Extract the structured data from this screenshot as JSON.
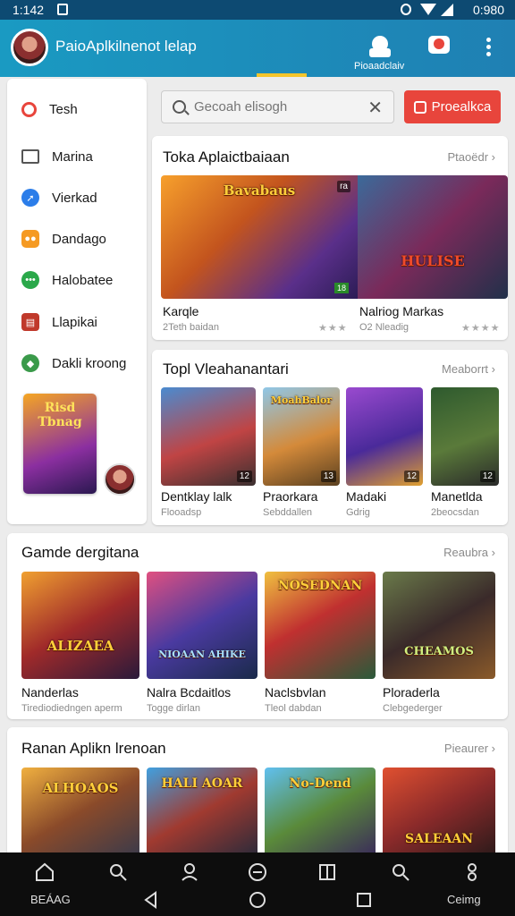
{
  "status": {
    "time": "1:142",
    "right": "0:980"
  },
  "appbar": {
    "title": "PaioAplkilnenot lelap",
    "button_label": "Pioaadclaiv"
  },
  "sidebar": {
    "items": [
      {
        "label": "Tesh",
        "icon": "search-icon",
        "color": "#e8453c"
      },
      {
        "label": "Marina",
        "icon": "list-icon",
        "color": "#555555"
      },
      {
        "label": "Vierkad",
        "icon": "compass-icon",
        "color": "#2b7de9"
      },
      {
        "label": "Dandago",
        "icon": "gamepad-icon",
        "color": "#f59a23"
      },
      {
        "label": "Halobatee",
        "icon": "chat-icon",
        "color": "#2aa84a"
      },
      {
        "label": "Llapikai",
        "icon": "tv-icon",
        "color": "#c0392b"
      },
      {
        "label": "Dakli kroong",
        "icon": "game-icon",
        "color": "#3a9a4a"
      }
    ],
    "promo_title": "Risd Tbnag"
  },
  "search": {
    "placeholder": "Gecoah elisogh",
    "button": "Proealkca"
  },
  "featured": {
    "title": "Toka Aplaictbaiaan",
    "more": "Ptaoëdr",
    "items": [
      {
        "name": "Karqle",
        "sub": "2Teth baidan",
        "art": "Bavabaus",
        "badge": "ra",
        "stars": "★★★"
      },
      {
        "name": "Nalriog Markas",
        "sub": "O2 Nleadig",
        "art": "HULISE",
        "stars": "★★★★"
      }
    ]
  },
  "top": {
    "title": "Topl Vleahanantari",
    "more": "Meaborrt",
    "items": [
      {
        "name": "Dentklay lalk",
        "sub": "Flooadsp",
        "art": "",
        "num": "12"
      },
      {
        "name": "Praorkara",
        "sub": "Sebddallen",
        "art": "MoahBalor",
        "num": "13"
      },
      {
        "name": "Madaki",
        "sub": "Gdrig",
        "art": "",
        "num": "12"
      },
      {
        "name": "Manetlda",
        "sub": "2beocsdan",
        "art": "",
        "num": "12"
      }
    ]
  },
  "games": {
    "title": "Gamde dergitana",
    "more": "Reaubra",
    "items": [
      {
        "name": "Nanderlas",
        "sub": "Tirediodiedngen aperm",
        "art": "ALIZAEA"
      },
      {
        "name": "Nalra Bcdaitlos",
        "sub": "Togge dirlan",
        "art": "NIOAAN AHIKE"
      },
      {
        "name": "Naclsbvlan",
        "sub": "Tleol dabdan",
        "art": "NOSEDNAN"
      },
      {
        "name": "Ploraderla",
        "sub": "Clebgederger",
        "art": "CHEAMOS"
      }
    ]
  },
  "apps": {
    "title": "Ranan Aplikn lrenoan",
    "more": "Pieaurer",
    "items": [
      {
        "art": "ALHOAOS"
      },
      {
        "art": "HALI AOAR"
      },
      {
        "art": "No-Dend"
      },
      {
        "art": "SALEAAN"
      }
    ]
  },
  "bottomnav": {
    "left_label": "BEÁAG",
    "right_label": "Ceimg"
  }
}
